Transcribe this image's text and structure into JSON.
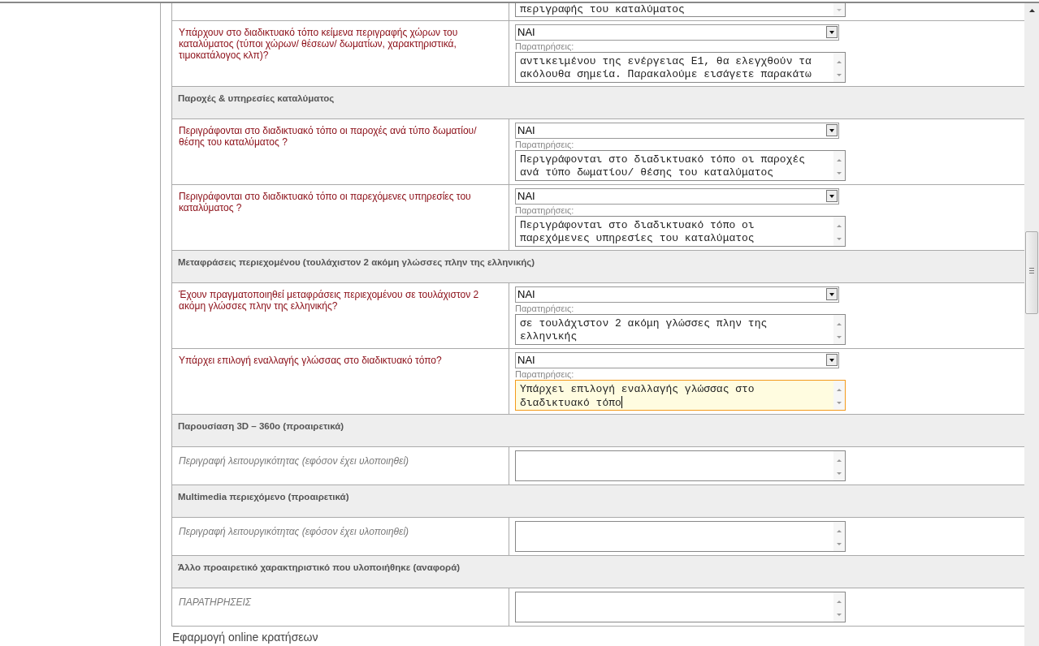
{
  "form": {
    "rows": [
      {
        "kind": "partial",
        "remarks": {
          "lines": [
            "περιγραφής του καταλύματος"
          ],
          "focused": false
        }
      },
      {
        "kind": "question",
        "label": "Υπάρχουν στο διαδικτυακό τόπο κείμενα περιγραφής χώρων του καταλύματος (τύποι χώρων/ θέσεων/ δωματίων, χαρακτηριστικά, τιμοκατάλογος κλπ)?",
        "answer": "ΝΑΙ",
        "remarks_label": "Παρατηρήσεις:",
        "remarks": {
          "lines": [
            "αντικειμένου της ενέργειας Ε1, θα ελεγχθούν τα",
            "ακόλουθα σημεία. Παρακαλούμε εισάγετε παρακάτω"
          ],
          "focused": false
        }
      },
      {
        "kind": "section",
        "title": "Παροχές & υπηρεσίες καταλύματος"
      },
      {
        "kind": "question",
        "label": "Περιγράφονται στο διαδικτυακό τόπο οι παροχές ανά τύπο δωματίου/ θέσης του καταλύματος ?",
        "answer": "ΝΑΙ",
        "remarks_label": "Παρατηρήσεις:",
        "remarks": {
          "lines": [
            "Περιγράφονται στο διαδικτυακό τόπο οι παροχές",
            "ανά τύπο δωματίου/ θέσης του καταλύματος"
          ],
          "focused": false
        }
      },
      {
        "kind": "question",
        "label": "Περιγράφονται στο διαδικτυακό τόπο οι παρεχόμενες υπηρεσίες του καταλύματος ?",
        "answer": "ΝΑΙ",
        "remarks_label": "Παρατηρήσεις:",
        "remarks": {
          "lines": [
            "Περιγράφονται στο διαδικτυακό τόπο οι",
            "παρεχόμενες υπηρεσίες του καταλύματος"
          ],
          "focused": false
        }
      },
      {
        "kind": "section",
        "title": "Μεταφράσεις περιεχομένου (τουλάχιστον 2 ακόμη γλώσσες πλην της ελληνικής)"
      },
      {
        "kind": "question",
        "label": "Έχουν πραγματοποιηθεί μεταφράσεις περιεχομένου σε τουλάχιστον 2 ακόμη γλώσσες πλην της ελληνικής?",
        "answer": "ΝΑΙ",
        "remarks_label": "Παρατηρήσεις:",
        "remarks": {
          "lines": [
            "σε τουλάχιστον 2 ακόμη γλώσσες πλην της",
            "ελληνικής"
          ],
          "focused": false
        }
      },
      {
        "kind": "question",
        "label": "Υπάρχει επιλογή εναλλαγής γλώσσας στο διαδικτυακό τόπο?",
        "answer": "ΝΑΙ",
        "remarks_label": "Παρατηρήσεις:",
        "remarks": {
          "lines": [
            "Υπάρχει επιλογή εναλλαγής γλώσσας στο",
            "διαδικτυακό τόπο"
          ],
          "focused": true
        }
      },
      {
        "kind": "section",
        "title": "Παρουσίαση 3D – 360ο (προαιρετικά)"
      },
      {
        "kind": "optional",
        "label": "Περιγραφή λειτουργικότητας (εφόσον έχει υλοποιηθεί)",
        "remarks": {
          "focused": false
        }
      },
      {
        "kind": "section",
        "title": "Multimedia περιεχόμενο (προαιρετικά)"
      },
      {
        "kind": "optional",
        "label": "Περιγραφή λειτουργικότητας (εφόσον έχει υλοποιηθεί)",
        "remarks": {
          "focused": false
        }
      },
      {
        "kind": "section",
        "title": "Άλλο προαιρετικό χαρακτηριστικό που υλοποιήθηκε (αναφορά)"
      },
      {
        "kind": "optional",
        "label": "ΠΑΡΑΤΗΡΗΣΕΙΣ",
        "remarks": {
          "focused": false
        }
      }
    ]
  },
  "next_heading": "Εφαρμογή online κρατήσεων"
}
